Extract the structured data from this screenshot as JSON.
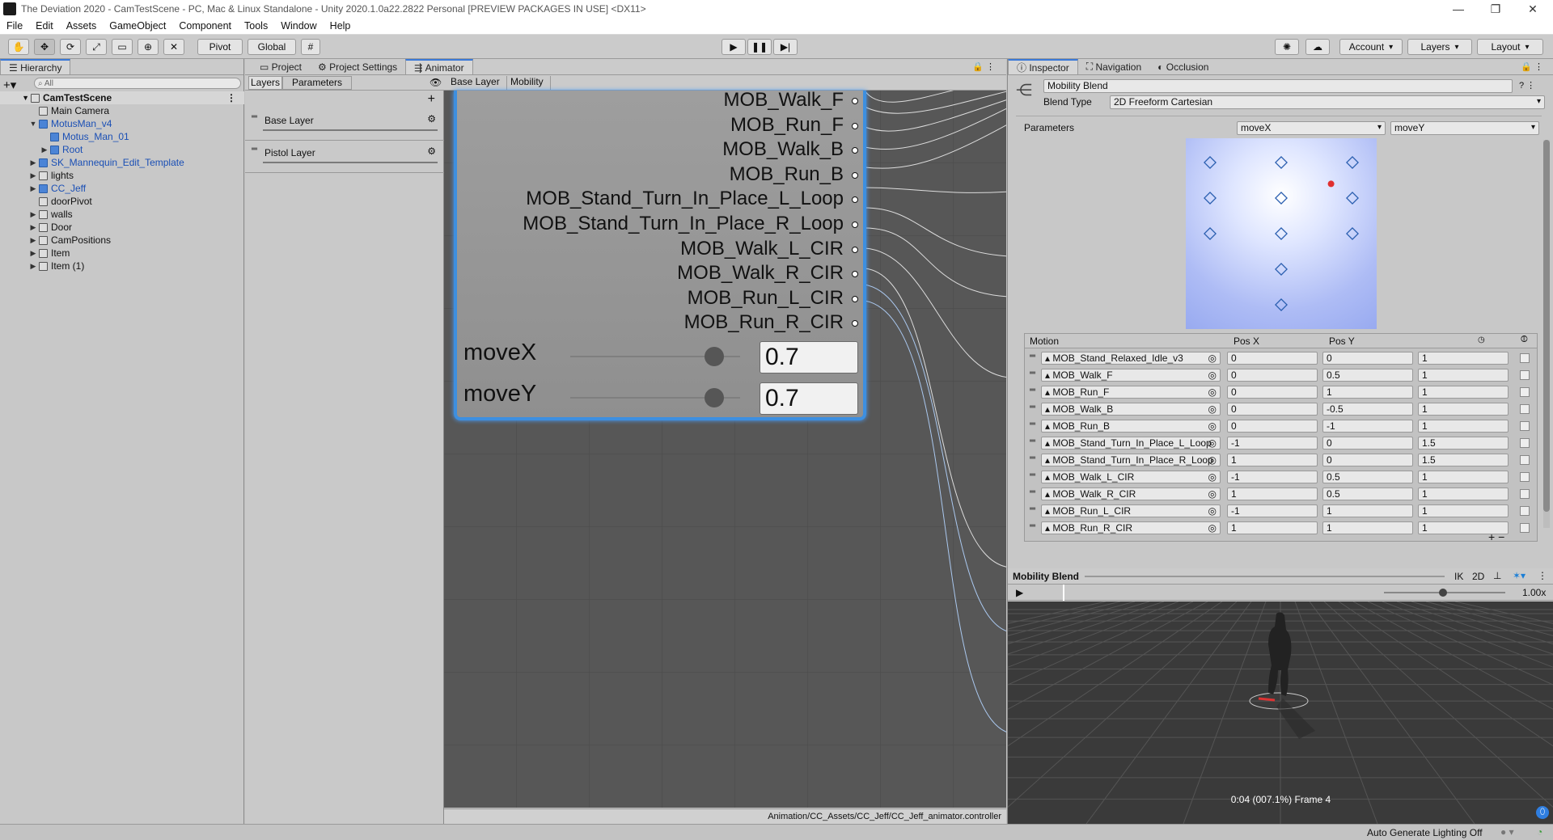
{
  "window": {
    "title": "The Deviation 2020 - CamTestScene - PC, Mac & Linux Standalone - Unity 2020.1.0a22.2822 Personal [PREVIEW PACKAGES IN USE] <DX11>"
  },
  "menu": [
    "File",
    "Edit",
    "Assets",
    "GameObject",
    "Component",
    "Tools",
    "Window",
    "Help"
  ],
  "toolbar": {
    "pivot": "Pivot",
    "global": "Global",
    "account": "Account",
    "layers": "Layers",
    "layout": "Layout"
  },
  "hierarchy": {
    "tab": "Hierarchy",
    "search_placeholder": "All",
    "scene": "CamTestScene",
    "items": [
      {
        "label": "Main Camera",
        "depth": 1,
        "expand": "",
        "style": "normal"
      },
      {
        "label": "MotusMan_v4",
        "depth": 1,
        "expand": "▼",
        "style": "blue"
      },
      {
        "label": "Motus_Man_01",
        "depth": 2,
        "expand": "",
        "style": "blue"
      },
      {
        "label": "Root",
        "depth": 2,
        "expand": "▶",
        "style": "blue"
      },
      {
        "label": "SK_Mannequin_Edit_Template",
        "depth": 1,
        "expand": "▶",
        "style": "blue"
      },
      {
        "label": "lights",
        "depth": 1,
        "expand": "▶",
        "style": "normal"
      },
      {
        "label": "CC_Jeff",
        "depth": 1,
        "expand": "▶",
        "style": "blue"
      },
      {
        "label": "doorPivot",
        "depth": 1,
        "expand": "",
        "style": "normal"
      },
      {
        "label": "walls",
        "depth": 1,
        "expand": "▶",
        "style": "normal"
      },
      {
        "label": "Door",
        "depth": 1,
        "expand": "▶",
        "style": "normal"
      },
      {
        "label": "CamPositions",
        "depth": 1,
        "expand": "▶",
        "style": "normal"
      },
      {
        "label": "Item",
        "depth": 1,
        "expand": "▶",
        "style": "normal"
      },
      {
        "label": "Item (1)",
        "depth": 1,
        "expand": "▶",
        "style": "normal"
      }
    ]
  },
  "animator": {
    "tabs": [
      "Project",
      "Project Settings",
      "Animator"
    ],
    "subtabs": [
      "Layers",
      "Parameters"
    ],
    "breadcrumb": [
      "Base Layer",
      "Mobility"
    ],
    "layers": [
      "Base Layer",
      "Pistol Layer"
    ],
    "motions": [
      "MOB_Walk_F",
      "MOB_Run_F",
      "MOB_Walk_B",
      "MOB_Run_B",
      "MOB_Stand_Turn_In_Place_L_Loop",
      "MOB_Stand_Turn_In_Place_R_Loop",
      "MOB_Walk_L_CIR",
      "MOB_Walk_R_CIR",
      "MOB_Run_L_CIR",
      "MOB_Run_R_CIR"
    ],
    "params": [
      {
        "name": "moveX",
        "value": "0.7"
      },
      {
        "name": "moveY",
        "value": "0.7"
      }
    ],
    "path": "Animation/CC_Assets/CC_Jeff/CC_Jeff_animator.controller"
  },
  "inspector": {
    "tabs": [
      "Inspector",
      "Navigation",
      "Occlusion"
    ],
    "name": "Mobility Blend",
    "blend_type_label": "Blend Type",
    "blend_type": "2D Freeform Cartesian",
    "parameters_label": "Parameters",
    "param_x": "moveX",
    "param_y": "moveY",
    "table_headers": [
      "Motion",
      "Pos X",
      "Pos Y"
    ],
    "rows": [
      {
        "motion": "MOB_Stand_Relaxed_Idle_v3",
        "x": "0",
        "y": "0",
        "speed": "1"
      },
      {
        "motion": "MOB_Walk_F",
        "x": "0",
        "y": "0.5",
        "speed": "1"
      },
      {
        "motion": "MOB_Run_F",
        "x": "0",
        "y": "1",
        "speed": "1"
      },
      {
        "motion": "MOB_Walk_B",
        "x": "0",
        "y": "-0.5",
        "speed": "1"
      },
      {
        "motion": "MOB_Run_B",
        "x": "0",
        "y": "-1",
        "speed": "1"
      },
      {
        "motion": "MOB_Stand_Turn_In_Place_L_Loop",
        "x": "-1",
        "y": "0",
        "speed": "1.5"
      },
      {
        "motion": "MOB_Stand_Turn_In_Place_R_Loop",
        "x": "1",
        "y": "0",
        "speed": "1.5"
      },
      {
        "motion": "MOB_Walk_L_CIR",
        "x": "-1",
        "y": "0.5",
        "speed": "1"
      },
      {
        "motion": "MOB_Walk_R_CIR",
        "x": "1",
        "y": "0.5",
        "speed": "1"
      },
      {
        "motion": "MOB_Run_L_CIR",
        "x": "-1",
        "y": "1",
        "speed": "1"
      },
      {
        "motion": "MOB_Run_R_CIR",
        "x": "1",
        "y": "1",
        "speed": "1"
      }
    ]
  },
  "preview": {
    "title": "Mobility Blend",
    "ik": "IK",
    "mode2d": "2D",
    "speed": "1.00x",
    "timecode": "0:04 (007.1%) Frame 4"
  },
  "status": {
    "lighting": "Auto Generate Lighting Off"
  }
}
